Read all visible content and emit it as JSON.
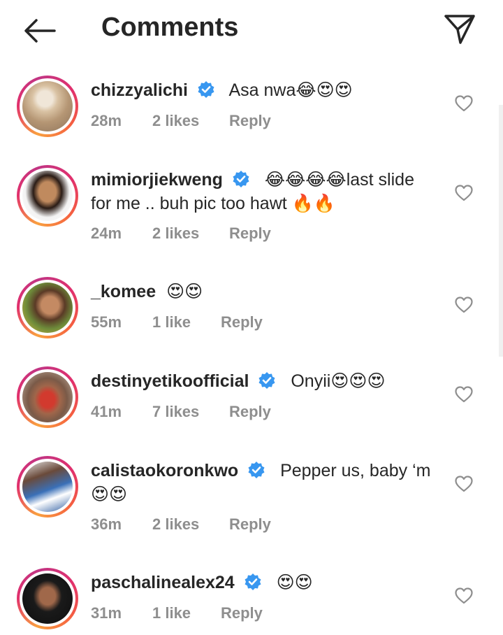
{
  "header": {
    "title": "Comments",
    "back_icon": "arrow-left-icon",
    "send_icon": "paper-plane-icon"
  },
  "colors": {
    "text": "#262626",
    "muted": "#8e8e8e",
    "verified": "#3897f0",
    "ring_start": "#f9a03f",
    "ring_end": "#e1306c"
  },
  "comments": [
    {
      "username": "chizzyalichi",
      "verified": true,
      "text": "Asa nwa😂😍😍",
      "time": "28m",
      "likes": "2 likes",
      "reply": "Reply"
    },
    {
      "username": "mimiorjiekweng",
      "verified": true,
      "text": "😂😂😂😂last slide for me .. buh pic too hawt 🔥🔥",
      "time": "24m",
      "likes": "2 likes",
      "reply": "Reply"
    },
    {
      "username": "_komee",
      "verified": false,
      "text": "😍😍",
      "time": "55m",
      "likes": "1 like",
      "reply": "Reply"
    },
    {
      "username": "destinyetikoofficial",
      "verified": true,
      "text": "Onyii😍😍😍",
      "time": "41m",
      "likes": "7 likes",
      "reply": "Reply"
    },
    {
      "username": "calistaokoronkwo",
      "verified": true,
      "text": "Pepper us, baby ‘m 😍😍",
      "time": "36m",
      "likes": "2 likes",
      "reply": "Reply"
    },
    {
      "username": "paschalinealex24",
      "verified": true,
      "text": "😍😍",
      "time": "31m",
      "likes": "1 like",
      "reply": "Reply"
    }
  ]
}
